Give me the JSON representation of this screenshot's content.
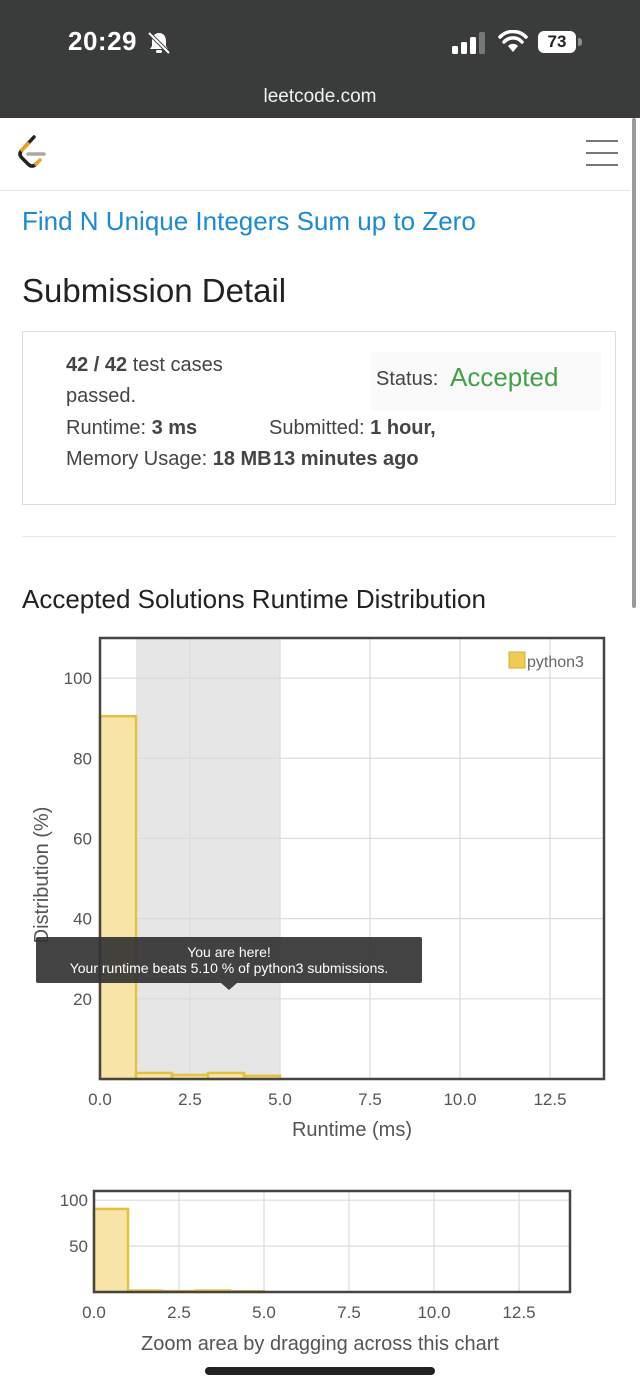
{
  "status_bar": {
    "time": "20:29",
    "battery": "73",
    "url": "leetcode.com",
    "icons": [
      "bell-slash-icon",
      "cellular-signal-icon",
      "wifi-icon",
      "battery-icon"
    ]
  },
  "nav": {
    "logo": "leetcode-logo",
    "menu_icon": "hamburger-menu-icon"
  },
  "problem_title": "Find N Unique Integers Sum up to Zero",
  "page_title": "Submission Detail",
  "details": {
    "test_cases": "42 / 42",
    "test_cases_suffix": " test cases",
    "passed": "passed.",
    "runtime_label": "Runtime: ",
    "runtime_value": "3 ms",
    "memory_label": "Memory Usage: ",
    "memory_value": "18 MB",
    "status_label": "Status: ",
    "status_value": "Accepted",
    "submitted_label": "Submitted: ",
    "submitted_value_1": "1 hour,",
    "submitted_value_2": "13 minutes ago"
  },
  "distribution_title": "Accepted Solutions Runtime Distribution",
  "colors": {
    "accepted": "#43a047",
    "link": "#1a8ad4",
    "bar_fill": "#f7e4a6",
    "bar_stroke": "#e5c143",
    "highlight": "#e6e6e6"
  },
  "chart_data": [
    {
      "type": "bar",
      "title": "",
      "xlabel": "Runtime (ms)",
      "ylabel": "Distribution (%)",
      "xlim": [
        0,
        14
      ],
      "ylim": [
        0,
        110
      ],
      "xticks": [
        "0.0",
        "2.5",
        "5.0",
        "7.5",
        "10.0",
        "12.5"
      ],
      "yticks": [
        "20",
        "40",
        "60",
        "80",
        "100"
      ],
      "legend": "top-right",
      "grid": true,
      "highlight_range": [
        1,
        5
      ],
      "series": [
        {
          "name": "python3",
          "bins": [
            [
              0,
              1
            ],
            [
              1,
              2
            ],
            [
              2,
              3
            ],
            [
              3,
              4
            ],
            [
              4,
              5
            ]
          ],
          "values": [
            90.5,
            1.5,
            1,
            1.5,
            0.8
          ]
        }
      ],
      "tooltip": {
        "line1": "You are here!",
        "line2": "Your runtime beats 5.10 % of python3 submissions."
      }
    },
    {
      "type": "bar",
      "title": "",
      "xlim": [
        0,
        14
      ],
      "ylim": [
        0,
        110
      ],
      "xticks": [
        "0.0",
        "2.5",
        "5.0",
        "7.5",
        "10.0",
        "12.5"
      ],
      "yticks": [
        "50",
        "100"
      ],
      "grid": true,
      "series": [
        {
          "bins": [
            [
              0,
              1
            ],
            [
              1,
              2
            ],
            [
              2,
              3
            ],
            [
              3,
              4
            ],
            [
              4,
              5
            ]
          ],
          "values": [
            90.5,
            1.5,
            1,
            1.5,
            0.8
          ]
        }
      ],
      "caption": "Zoom area by dragging across this chart"
    }
  ]
}
